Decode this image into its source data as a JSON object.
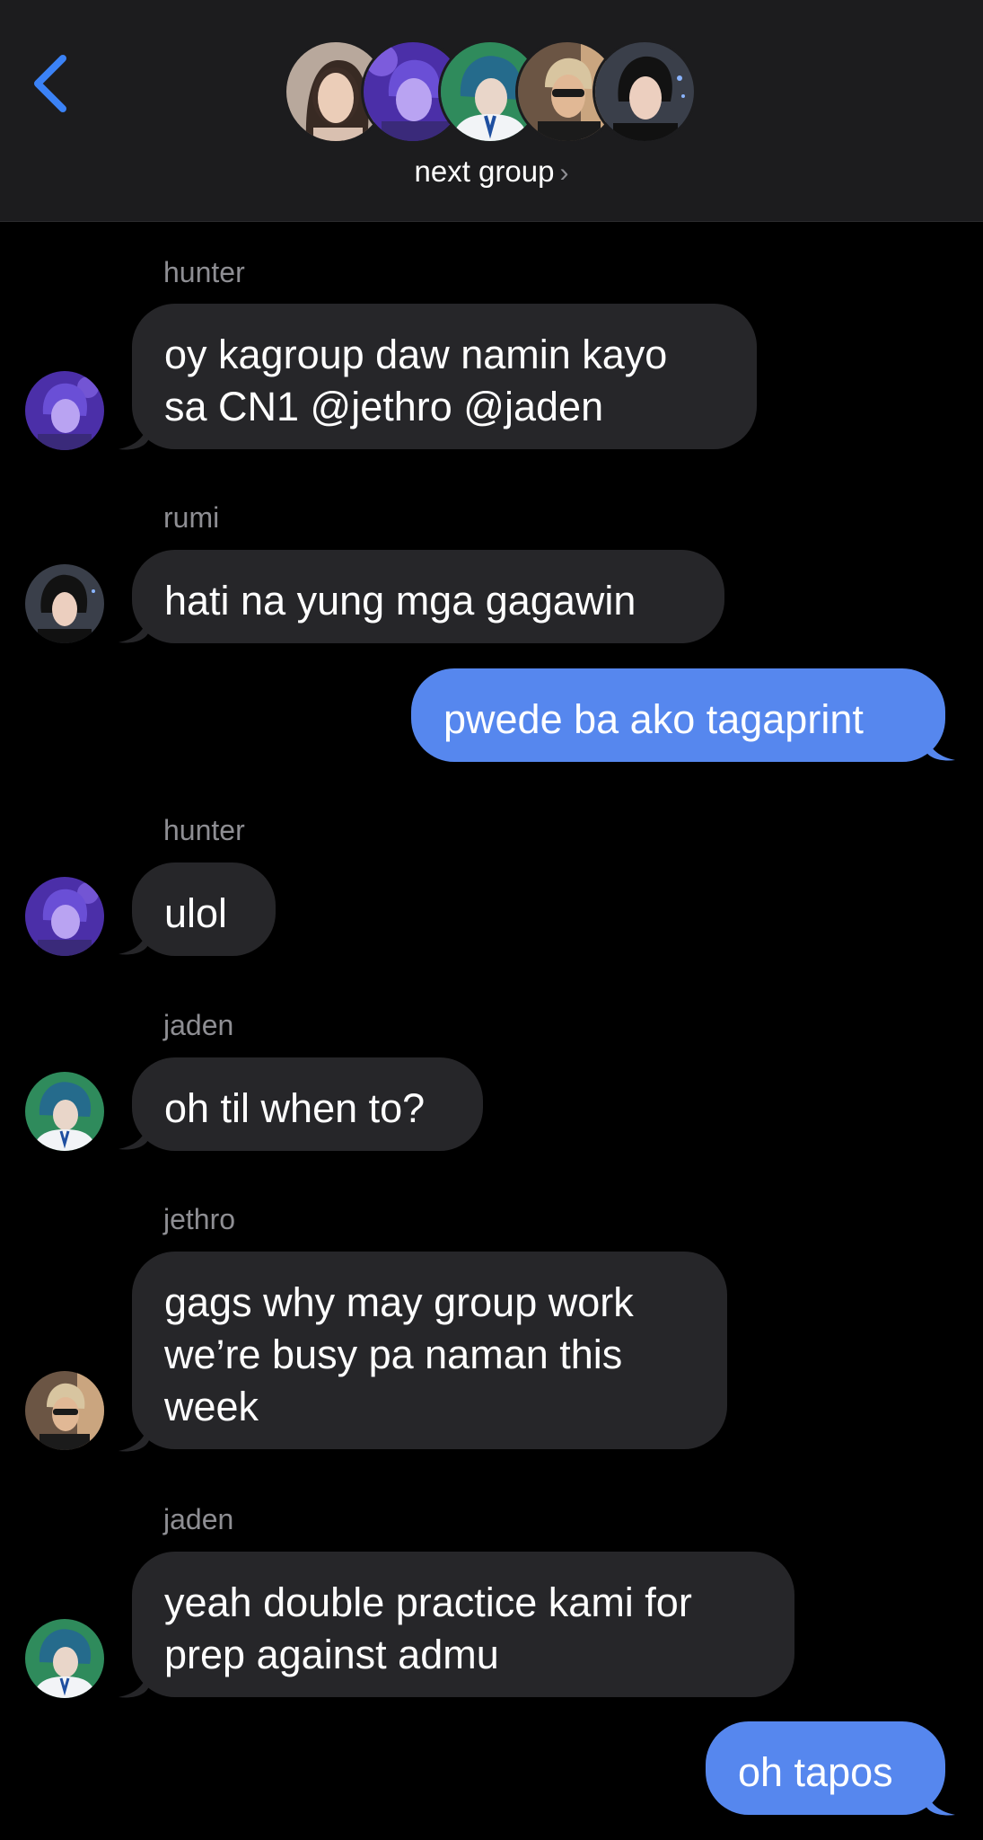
{
  "header": {
    "group_name": "next group",
    "chevron": "›"
  },
  "colors": {
    "background": "#000000",
    "header": "#1c1c1e",
    "incoming_bubble": "#262629",
    "outgoing_bubble": "#5687ee",
    "accent": "#3b82f6",
    "sender_text": "#8e8e93"
  },
  "messages": [
    {
      "sender": "hunter",
      "lines": [
        "oy kagroup daw namin kayo",
        "sa CN1 @jethro @jaden"
      ],
      "direction": "incoming",
      "avatar": "hunter-avatar"
    },
    {
      "sender": "rumi",
      "lines": [
        "hati na yung mga gagawin"
      ],
      "direction": "incoming",
      "avatar": "rumi-avatar"
    },
    {
      "lines": [
        "pwede ba ako tagaprint"
      ],
      "direction": "outgoing"
    },
    {
      "sender": "hunter",
      "lines": [
        "ulol"
      ],
      "direction": "incoming",
      "avatar": "hunter-avatar"
    },
    {
      "sender": "jaden",
      "lines": [
        "oh til when to?"
      ],
      "direction": "incoming",
      "avatar": "jaden-avatar"
    },
    {
      "sender": "jethro",
      "lines": [
        "gags why may group work",
        "we’re busy pa naman this",
        "week"
      ],
      "direction": "incoming",
      "avatar": "jethro-avatar"
    },
    {
      "sender": "jaden",
      "lines": [
        "yeah double practice kami for",
        "prep against admu"
      ],
      "direction": "incoming",
      "avatar": "jaden-avatar"
    },
    {
      "lines": [
        "oh tapos"
      ],
      "direction": "outgoing"
    }
  ]
}
